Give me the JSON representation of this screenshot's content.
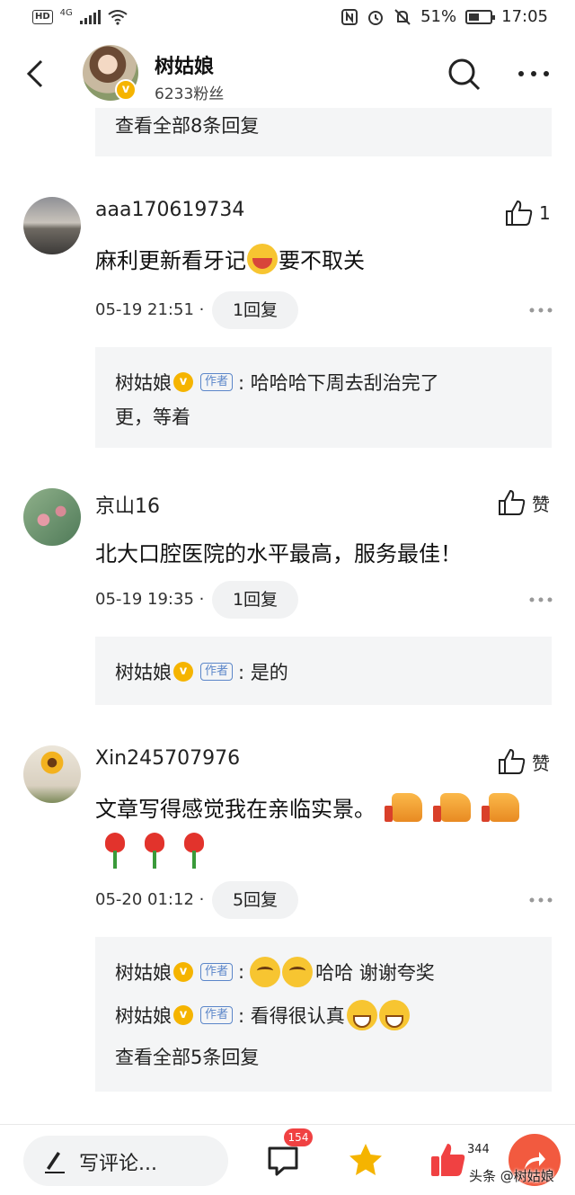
{
  "status_bar": {
    "hd": "HD",
    "network": "4G",
    "battery_percent": "51%",
    "battery_level": 0.51,
    "time": "17:05"
  },
  "header": {
    "author_name": "树姑娘",
    "fans": "6233粉丝"
  },
  "top_reply": {
    "view_all": "查看全部8条回复"
  },
  "comments": [
    {
      "username": "aaa170619734",
      "like_label": "1",
      "text_before": "麻利更新看牙记",
      "text_after": "要不取关",
      "time": "05-19 21:51 ·",
      "reply_count": "1回复",
      "replies": [
        {
          "author": "树姑娘",
          "tag": "作者",
          "text_line1": ": 哈哈哈下周去刮治完了",
          "text_line2": "更，等着"
        }
      ]
    },
    {
      "username": "京山16",
      "like_label": "赞",
      "text": "北大口腔医院的水平最高，服务最佳！",
      "time": "05-19 19:35 ·",
      "reply_count": "1回复",
      "replies": [
        {
          "author": "树姑娘",
          "tag": "作者",
          "text": ": 是的"
        }
      ]
    },
    {
      "username": "Xin245707976",
      "like_label": "赞",
      "text": "文章写得感觉我在亲临实景。",
      "time": "05-20 01:12 ·",
      "reply_count": "5回复",
      "replies": [
        {
          "author": "树姑娘",
          "tag": "作者",
          "text_prefix": ":",
          "text": "哈哈 谢谢夸奖"
        },
        {
          "author": "树姑娘",
          "tag": "作者",
          "text": ": 看得很认真"
        }
      ],
      "view_all": "查看全部5条回复"
    }
  ],
  "bottom_bar": {
    "write_placeholder": "写评论...",
    "comment_count": "154",
    "like_count": "344",
    "watermark": "头条 @树姑娘"
  },
  "colors": {
    "reply_bg": "#f4f5f6",
    "verified": "#f5b400",
    "author_tag": "#5b86c9",
    "badge_red": "#f04142",
    "share_orange": "#f25a3f"
  }
}
